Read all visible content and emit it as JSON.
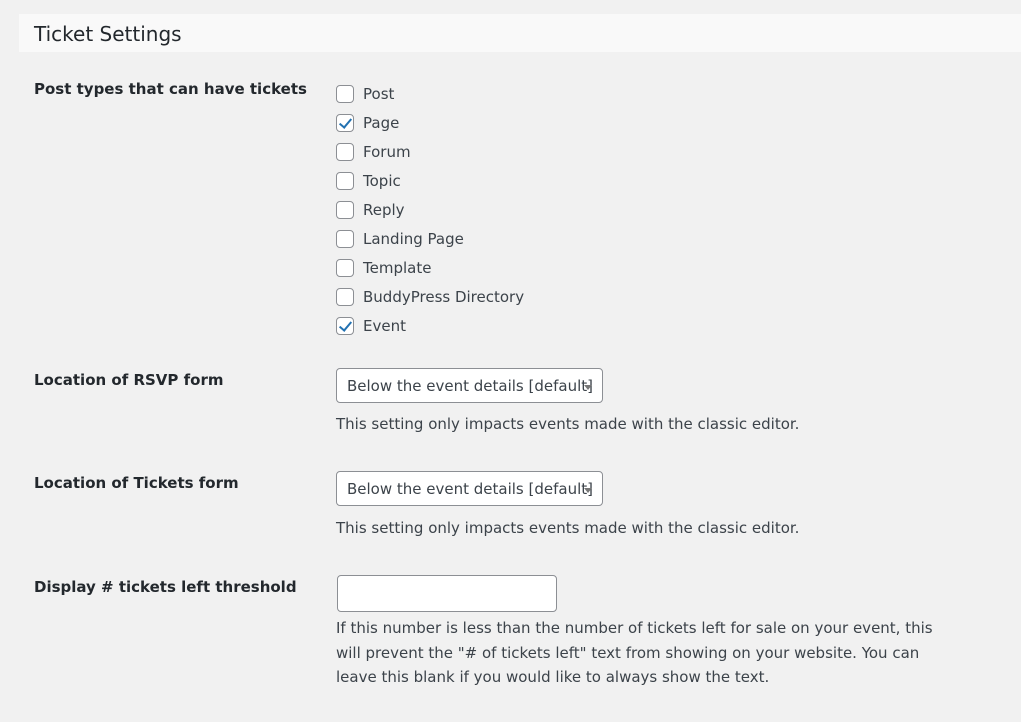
{
  "section": {
    "title": "Ticket Settings"
  },
  "post_types": {
    "label": "Post types that can have tickets",
    "options": [
      {
        "label": "Post",
        "checked": false
      },
      {
        "label": "Page",
        "checked": true
      },
      {
        "label": "Forum",
        "checked": false
      },
      {
        "label": "Topic",
        "checked": false
      },
      {
        "label": "Reply",
        "checked": false
      },
      {
        "label": "Landing Page",
        "checked": false
      },
      {
        "label": "Template",
        "checked": false
      },
      {
        "label": "BuddyPress Directory",
        "checked": false
      },
      {
        "label": "Event",
        "checked": true
      }
    ]
  },
  "rsvp_location": {
    "label": "Location of RSVP form",
    "selected": "Below the event details [default]",
    "description": "This setting only impacts events made with the classic editor."
  },
  "tickets_location": {
    "label": "Location of Tickets form",
    "selected": "Below the event details [default]",
    "description": "This setting only impacts events made with the classic editor."
  },
  "tickets_left_threshold": {
    "label": "Display # tickets left threshold",
    "value": "",
    "description_lines": [
      "If this number is less than the number of tickets left for sale on your event, this",
      "will prevent the \"# of tickets left\" text from showing on your website. You can",
      "leave this blank if you would like to always show the text."
    ]
  },
  "colors": {
    "page_background": "#f1f1f1",
    "header_background": "#f9f9f9",
    "checkmark": "#2271b1",
    "control_border": "#8c8f94"
  }
}
